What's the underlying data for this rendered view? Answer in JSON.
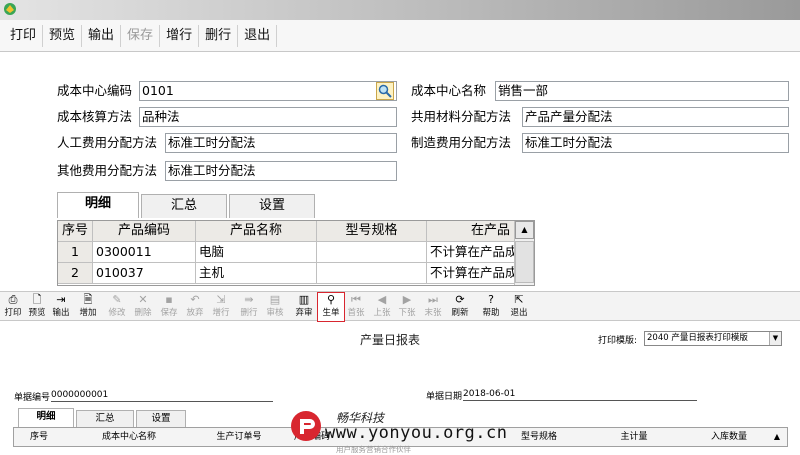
{
  "menu": [
    {
      "label": "打印",
      "enabled": true
    },
    {
      "label": "预览",
      "enabled": true
    },
    {
      "label": "输出",
      "enabled": true
    },
    {
      "label": "保存",
      "enabled": false
    },
    {
      "label": "增行",
      "enabled": true
    },
    {
      "label": "删行",
      "enabled": true
    },
    {
      "label": "退出",
      "enabled": true
    }
  ],
  "form": {
    "cost_center_code": {
      "label": "成本中心编码",
      "value": "0101"
    },
    "cost_center_name": {
      "label": "成本中心名称",
      "value": "销售一部"
    },
    "costing_method": {
      "label": "成本核算方法",
      "value": "品种法"
    },
    "shared_material_alloc": {
      "label": "共用材料分配方法",
      "value": "产品产量分配法"
    },
    "labor_alloc": {
      "label": "人工费用分配方法",
      "value": "标准工时分配法"
    },
    "manufacturing_alloc": {
      "label": "制造费用分配方法",
      "value": "标准工时分配法"
    },
    "other_alloc": {
      "label": "其他费用分配方法",
      "value": "标准工时分配法"
    }
  },
  "tabs": [
    "明细",
    "汇总",
    "设置"
  ],
  "grid": {
    "columns": [
      "序号",
      "产品编码",
      "产品名称",
      "型号规格",
      "在产品"
    ],
    "rows": [
      {
        "no": "1",
        "code": "0300011",
        "name": "电脑",
        "spec": "",
        "wip": "不计算在产品成本"
      },
      {
        "no": "2",
        "code": "010037",
        "name": "主机",
        "spec": "",
        "wip": "不计算在产品成本"
      }
    ]
  },
  "toolbar": [
    {
      "label": "打印",
      "icon": "printer-icon",
      "glyph": "⎙",
      "enabled": true
    },
    {
      "label": "预览",
      "icon": "preview-icon",
      "glyph": "🗋",
      "enabled": true
    },
    {
      "label": "输出",
      "icon": "export-icon",
      "glyph": "⇥",
      "enabled": true
    },
    {
      "label": "增加",
      "icon": "add-icon",
      "glyph": "🗎",
      "enabled": true
    },
    {
      "label": "修改",
      "icon": "edit-icon",
      "glyph": "✎",
      "enabled": false
    },
    {
      "label": "删除",
      "icon": "delete-icon",
      "glyph": "✕",
      "enabled": false
    },
    {
      "label": "保存",
      "icon": "save-icon",
      "glyph": "▪",
      "enabled": false
    },
    {
      "label": "放弃",
      "icon": "undo-icon",
      "glyph": "↶",
      "enabled": false
    },
    {
      "label": "增行",
      "icon": "add-row-icon",
      "glyph": "⇲",
      "enabled": false
    },
    {
      "label": "删行",
      "icon": "delete-row-icon",
      "glyph": "⇛",
      "enabled": false
    },
    {
      "label": "审核",
      "icon": "approve-icon",
      "glyph": "▤",
      "enabled": false
    },
    {
      "label": "弃审",
      "icon": "unapprove-icon",
      "glyph": "▥",
      "enabled": true
    },
    {
      "label": "生单",
      "icon": "generate-icon",
      "glyph": "⚲",
      "enabled": true
    },
    {
      "label": "首张",
      "icon": "first-record-icon",
      "glyph": "⏮",
      "enabled": false
    },
    {
      "label": "上张",
      "icon": "prev-record-icon",
      "glyph": "◀",
      "enabled": false
    },
    {
      "label": "下张",
      "icon": "next-record-icon",
      "glyph": "▶",
      "enabled": false
    },
    {
      "label": "末张",
      "icon": "last-record-icon",
      "glyph": "⏭",
      "enabled": false
    },
    {
      "label": "刷新",
      "icon": "refresh-icon",
      "glyph": "⟳",
      "enabled": true
    },
    {
      "label": "帮助",
      "icon": "help-icon",
      "glyph": "?",
      "enabled": true
    },
    {
      "label": "退出",
      "icon": "exit-icon",
      "glyph": "⇱",
      "enabled": true
    }
  ],
  "report": {
    "title": "产量日报表",
    "template_label": "打印模版:",
    "template_value": "2040 产量日报表打印模版",
    "doc_no_label": "单据编号",
    "doc_no": "0000000001",
    "doc_date_label": "单据日期",
    "doc_date": "2018-06-01",
    "tabs": [
      "明细",
      "汇总",
      "设置"
    ],
    "columns": [
      "序号",
      "成本中心名称",
      "生产订单号",
      "产品编码",
      "产品名称",
      "型号规格",
      "主计量",
      "入库数量"
    ]
  },
  "watermark": {
    "brand_cn": "畅华科技",
    "url": "www.yonyou.org.cn",
    "sub": "用户服务营销合作伙伴"
  },
  "colors": {
    "accent": "#d8262f",
    "toolbar_bg": "#f3f3f3",
    "header_bg": "#eceae6"
  }
}
